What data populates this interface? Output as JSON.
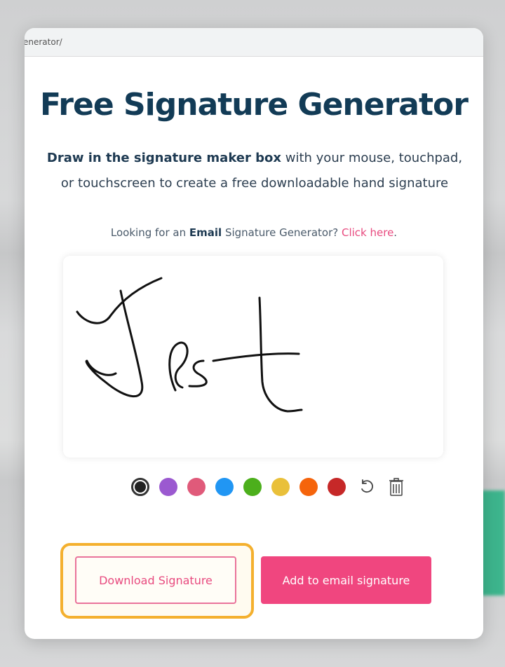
{
  "browser": {
    "url_fragment": "enerator/"
  },
  "page": {
    "title": "Free Signature Generator",
    "subtitle_bold": "Draw in the signature maker box",
    "subtitle_rest_line1": " with your mouse, touchpad,",
    "subtitle_line2": "or touchscreen to create a free downloadable hand signature",
    "hint_prefix": "Looking for an ",
    "hint_bold": "Email",
    "hint_middle": " Signature Generator? ",
    "hint_link": "Click here",
    "hint_suffix": "."
  },
  "palette": {
    "colors": [
      "#222222",
      "#9b59d0",
      "#e05a7a",
      "#2196f3",
      "#4caf1c",
      "#e9c03a",
      "#f5640c",
      "#c62828"
    ],
    "selected_index": 0
  },
  "tools": {
    "undo_icon": "undo-icon",
    "trash_icon": "trash-icon"
  },
  "buttons": {
    "download_label": "Download Signature",
    "add_label": "Add to email signature"
  }
}
